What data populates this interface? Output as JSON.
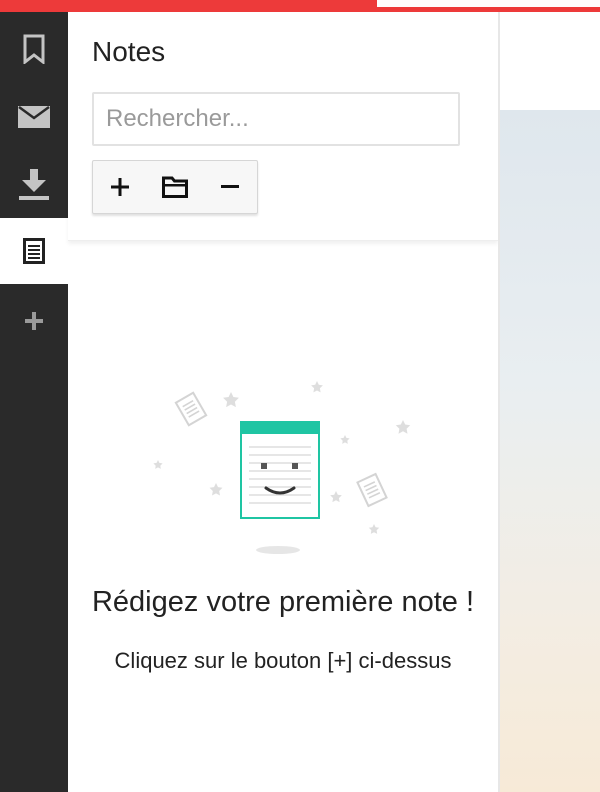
{
  "panel": {
    "title": "Notes",
    "search_placeholder": "Rechercher...",
    "toolbar": [
      {
        "name": "add-note-button",
        "icon": "plus-icon"
      },
      {
        "name": "folder-button",
        "icon": "folder-icon"
      },
      {
        "name": "remove-note-button",
        "icon": "minus-icon"
      }
    ]
  },
  "sidebar": {
    "items": [
      {
        "name": "bookmarks",
        "icon": "bookmark-icon",
        "active": false
      },
      {
        "name": "mail",
        "icon": "mail-icon",
        "active": false
      },
      {
        "name": "downloads",
        "icon": "download-icon",
        "active": false
      },
      {
        "name": "notes",
        "icon": "notes-icon",
        "active": true
      },
      {
        "name": "add-panel",
        "icon": "plus-icon",
        "active": false
      }
    ]
  },
  "empty_state": {
    "title": "Rédigez votre première note !",
    "subtitle": "Cliquez sur le bouton [+] ci-dessus"
  },
  "colors": {
    "accent_red": "#ed3a3a",
    "sidebar_bg": "#2a2a2a",
    "illustration_teal": "#1fc5a3"
  }
}
